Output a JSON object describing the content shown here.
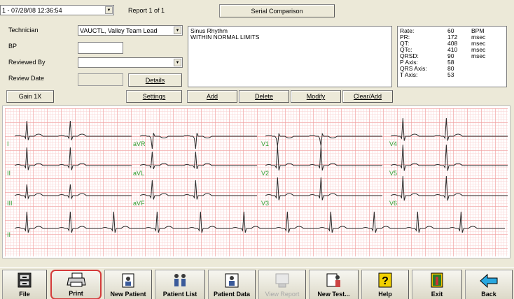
{
  "header": {
    "timestamp_select": "1 - 07/28/08 12:36:54",
    "report_label": "Report 1 of 1",
    "serial_comparison_label": "Serial Comparison"
  },
  "form": {
    "technician_label": "Technician",
    "technician_value": "VAUCTL, Valley Team Lead",
    "bp_label": "BP",
    "bp_value": "",
    "reviewed_by_label": "Reviewed By",
    "reviewed_by_value": "",
    "review_date_label": "Review Date",
    "review_date_value": "",
    "details_label": "Details"
  },
  "interpretation": {
    "line1": "Sinus Rhythm",
    "line2": "WITHIN NORMAL LIMITS"
  },
  "buttons": {
    "gain": "Gain 1X",
    "settings": "Settings",
    "add": "Add",
    "delete": "Delete",
    "modify": "Modify",
    "clear_add": "Clear/Add"
  },
  "measurements": [
    {
      "label": "Rate:",
      "value": "60",
      "unit": "BPM"
    },
    {
      "label": "PR:",
      "value": "172",
      "unit": "msec"
    },
    {
      "label": "QT:",
      "value": "408",
      "unit": "msec"
    },
    {
      "label": "QTc:",
      "value": "410",
      "unit": "msec"
    },
    {
      "label": "QRSD:",
      "value": "90",
      "unit": "msec"
    },
    {
      "label": "P Axis:",
      "value": "58",
      "unit": ""
    },
    {
      "label": "QRS Axis:",
      "value": "80",
      "unit": ""
    },
    {
      "label": "T Axis:",
      "value": "53",
      "unit": ""
    }
  ],
  "ecg": {
    "row_labels": [
      "I",
      "II",
      "III",
      "II"
    ],
    "leads": {
      "avr": "aVR",
      "avl": "aVL",
      "avf": "aVF",
      "v1": "V1",
      "v2": "V2",
      "v3": "V3",
      "v4": "V4",
      "v5": "V5",
      "v6": "V6"
    },
    "trace_color": "#2a2a2a",
    "label_color": "#2f9e2f"
  },
  "toolbar": {
    "file": "File",
    "print": "Print",
    "new_patient": "New Patient",
    "patient_list": "Patient List",
    "patient_data": "Patient Data",
    "view_report": "View Report",
    "new_test": "New Test...",
    "help": "Help",
    "exit": "Exit",
    "back": "Back"
  }
}
